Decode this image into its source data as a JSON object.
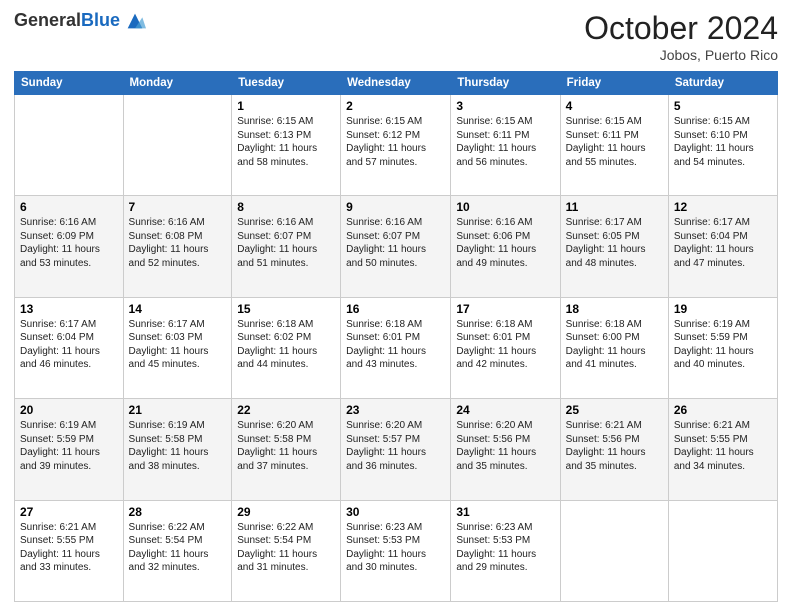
{
  "header": {
    "logo_general": "General",
    "logo_blue": "Blue",
    "month_title": "October 2024",
    "location": "Jobos, Puerto Rico"
  },
  "days_of_week": [
    "Sunday",
    "Monday",
    "Tuesday",
    "Wednesday",
    "Thursday",
    "Friday",
    "Saturday"
  ],
  "weeks": [
    [
      {
        "day": "",
        "info": ""
      },
      {
        "day": "",
        "info": ""
      },
      {
        "day": "1",
        "info": "Sunrise: 6:15 AM\nSunset: 6:13 PM\nDaylight: 11 hours and 58 minutes."
      },
      {
        "day": "2",
        "info": "Sunrise: 6:15 AM\nSunset: 6:12 PM\nDaylight: 11 hours and 57 minutes."
      },
      {
        "day": "3",
        "info": "Sunrise: 6:15 AM\nSunset: 6:11 PM\nDaylight: 11 hours and 56 minutes."
      },
      {
        "day": "4",
        "info": "Sunrise: 6:15 AM\nSunset: 6:11 PM\nDaylight: 11 hours and 55 minutes."
      },
      {
        "day": "5",
        "info": "Sunrise: 6:15 AM\nSunset: 6:10 PM\nDaylight: 11 hours and 54 minutes."
      }
    ],
    [
      {
        "day": "6",
        "info": "Sunrise: 6:16 AM\nSunset: 6:09 PM\nDaylight: 11 hours and 53 minutes."
      },
      {
        "day": "7",
        "info": "Sunrise: 6:16 AM\nSunset: 6:08 PM\nDaylight: 11 hours and 52 minutes."
      },
      {
        "day": "8",
        "info": "Sunrise: 6:16 AM\nSunset: 6:07 PM\nDaylight: 11 hours and 51 minutes."
      },
      {
        "day": "9",
        "info": "Sunrise: 6:16 AM\nSunset: 6:07 PM\nDaylight: 11 hours and 50 minutes."
      },
      {
        "day": "10",
        "info": "Sunrise: 6:16 AM\nSunset: 6:06 PM\nDaylight: 11 hours and 49 minutes."
      },
      {
        "day": "11",
        "info": "Sunrise: 6:17 AM\nSunset: 6:05 PM\nDaylight: 11 hours and 48 minutes."
      },
      {
        "day": "12",
        "info": "Sunrise: 6:17 AM\nSunset: 6:04 PM\nDaylight: 11 hours and 47 minutes."
      }
    ],
    [
      {
        "day": "13",
        "info": "Sunrise: 6:17 AM\nSunset: 6:04 PM\nDaylight: 11 hours and 46 minutes."
      },
      {
        "day": "14",
        "info": "Sunrise: 6:17 AM\nSunset: 6:03 PM\nDaylight: 11 hours and 45 minutes."
      },
      {
        "day": "15",
        "info": "Sunrise: 6:18 AM\nSunset: 6:02 PM\nDaylight: 11 hours and 44 minutes."
      },
      {
        "day": "16",
        "info": "Sunrise: 6:18 AM\nSunset: 6:01 PM\nDaylight: 11 hours and 43 minutes."
      },
      {
        "day": "17",
        "info": "Sunrise: 6:18 AM\nSunset: 6:01 PM\nDaylight: 11 hours and 42 minutes."
      },
      {
        "day": "18",
        "info": "Sunrise: 6:18 AM\nSunset: 6:00 PM\nDaylight: 11 hours and 41 minutes."
      },
      {
        "day": "19",
        "info": "Sunrise: 6:19 AM\nSunset: 5:59 PM\nDaylight: 11 hours and 40 minutes."
      }
    ],
    [
      {
        "day": "20",
        "info": "Sunrise: 6:19 AM\nSunset: 5:59 PM\nDaylight: 11 hours and 39 minutes."
      },
      {
        "day": "21",
        "info": "Sunrise: 6:19 AM\nSunset: 5:58 PM\nDaylight: 11 hours and 38 minutes."
      },
      {
        "day": "22",
        "info": "Sunrise: 6:20 AM\nSunset: 5:58 PM\nDaylight: 11 hours and 37 minutes."
      },
      {
        "day": "23",
        "info": "Sunrise: 6:20 AM\nSunset: 5:57 PM\nDaylight: 11 hours and 36 minutes."
      },
      {
        "day": "24",
        "info": "Sunrise: 6:20 AM\nSunset: 5:56 PM\nDaylight: 11 hours and 35 minutes."
      },
      {
        "day": "25",
        "info": "Sunrise: 6:21 AM\nSunset: 5:56 PM\nDaylight: 11 hours and 35 minutes."
      },
      {
        "day": "26",
        "info": "Sunrise: 6:21 AM\nSunset: 5:55 PM\nDaylight: 11 hours and 34 minutes."
      }
    ],
    [
      {
        "day": "27",
        "info": "Sunrise: 6:21 AM\nSunset: 5:55 PM\nDaylight: 11 hours and 33 minutes."
      },
      {
        "day": "28",
        "info": "Sunrise: 6:22 AM\nSunset: 5:54 PM\nDaylight: 11 hours and 32 minutes."
      },
      {
        "day": "29",
        "info": "Sunrise: 6:22 AM\nSunset: 5:54 PM\nDaylight: 11 hours and 31 minutes."
      },
      {
        "day": "30",
        "info": "Sunrise: 6:23 AM\nSunset: 5:53 PM\nDaylight: 11 hours and 30 minutes."
      },
      {
        "day": "31",
        "info": "Sunrise: 6:23 AM\nSunset: 5:53 PM\nDaylight: 11 hours and 29 minutes."
      },
      {
        "day": "",
        "info": ""
      },
      {
        "day": "",
        "info": ""
      }
    ]
  ]
}
